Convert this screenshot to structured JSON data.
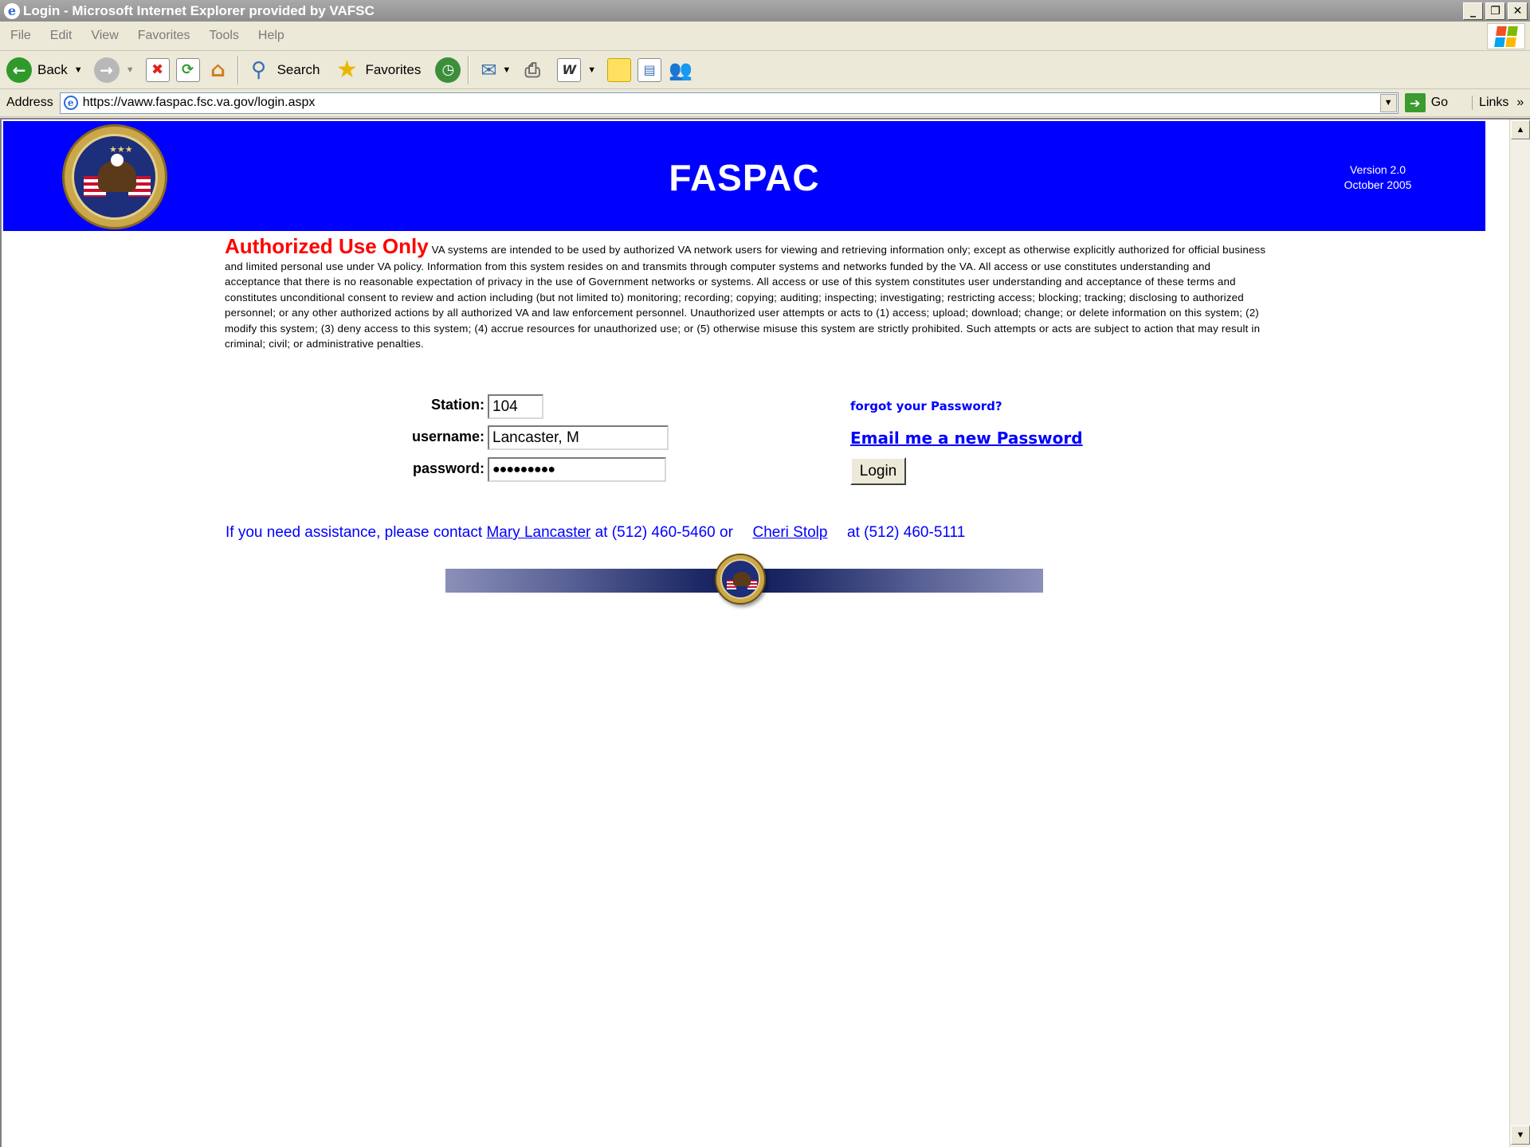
{
  "window": {
    "title": "Login - Microsoft Internet Explorer provided by VAFSC",
    "minimize": "_",
    "restore": "❐",
    "close": "✕"
  },
  "menu": [
    "File",
    "Edit",
    "View",
    "Favorites",
    "Tools",
    "Help"
  ],
  "toolbar": {
    "back_label": "Back",
    "search_label": "Search",
    "favorites_label": "Favorites"
  },
  "address": {
    "label": "Address",
    "url": "https://vaww.faspac.fsc.va.gov/login.aspx",
    "go_label": "Go",
    "links_label": "Links"
  },
  "banner": {
    "title": "FASPAC",
    "version": "Version 2.0",
    "date": "October 2005"
  },
  "notice": {
    "heading": "Authorized Use Only",
    "body": "VA systems are intended to be used by authorized VA network users for viewing and retrieving information only; except as otherwise explicitly authorized for official business and limited personal use under VA policy. Information from this system resides on and transmits through computer systems and networks funded by the VA. All access or use constitutes understanding and acceptance that there is no reasonable expectation of privacy in the use of Government networks or systems. All access or use of this system constitutes user understanding and acceptance of these terms and constitutes unconditional consent to review and action including (but not limited to) monitoring; recording; copying; auditing; inspecting; investigating; restricting access; blocking; tracking; disclosing to authorized personnel; or any other authorized actions by all authorized VA and law enforcement personnel. Unauthorized user attempts or acts to (1) access; upload; download; change; or delete information on this system; (2) modify this system; (3) deny access to this system; (4) accrue resources for unauthorized use; or (5) otherwise misuse this system are strictly prohibited. Such attempts or acts are subject to action that may result in criminal; civil; or administrative penalties."
  },
  "form": {
    "station_label": "Station:",
    "station_value": "104",
    "username_label": "username:",
    "username_value": "Lancaster, M",
    "password_label": "password:",
    "password_value": "●●●●●●●●●",
    "forgot_text": "forgot your Password?",
    "email_link": "Email me a new Password",
    "login_button": "Login"
  },
  "assistance": {
    "prefix": "If you need assistance, please contact",
    "contact1": "Mary Lancaster",
    "phone1": "at (512) 460-5460 or",
    "contact2": "Cheri Stolp",
    "phone2": "at (512) 460-5111"
  },
  "colors": {
    "banner": "#0000ff",
    "heading": "#ff0000",
    "link": "#0000ff"
  }
}
